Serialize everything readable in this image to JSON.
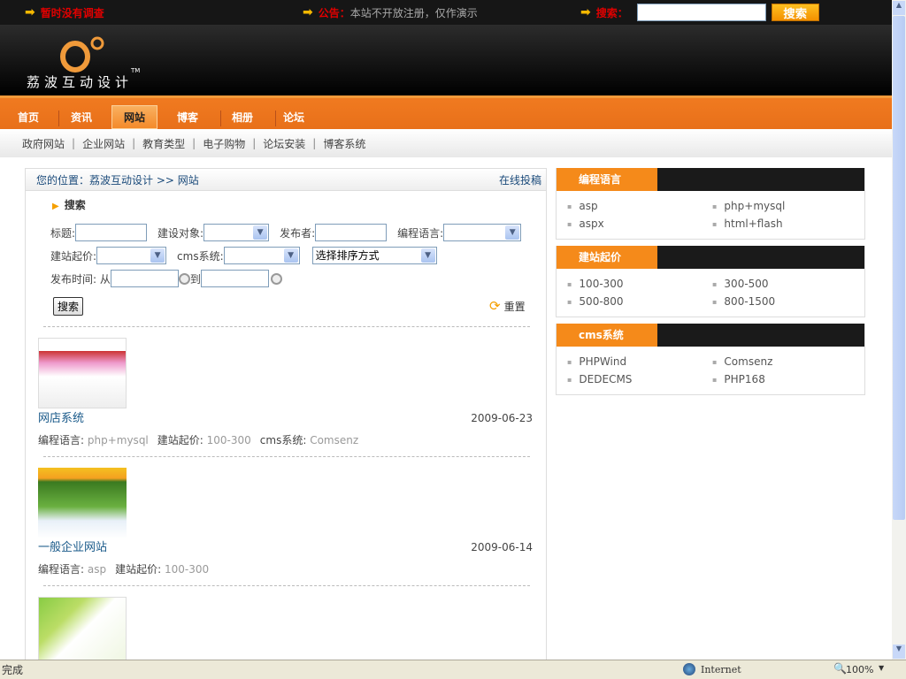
{
  "topbar": {
    "survey": "暂时没有调查",
    "notice_label": "公告：",
    "notice_text": "本站不开放注册，仅作演示",
    "search_label": "搜索：",
    "search_button": "搜索",
    "search_value": ""
  },
  "logo": {
    "text": "荔波互动设计",
    "tm": "TM"
  },
  "nav": [
    {
      "label": "首页"
    },
    {
      "label": "资讯"
    },
    {
      "label": "网站",
      "active": true
    },
    {
      "label": "博客"
    },
    {
      "label": "相册"
    },
    {
      "label": "论坛"
    }
  ],
  "subnav": [
    "政府网站",
    "企业网站",
    "教育类型",
    "电子购物",
    "论坛安装",
    "博客系统"
  ],
  "breadcrumb": {
    "prefix": "您的位置：",
    "home": "荔波互动设计",
    "sep": ">>",
    "current": "网站",
    "submit_link": "在线投稿"
  },
  "search": {
    "heading": "搜索",
    "title_label": "标题:",
    "target_label": "建设对象:",
    "publisher_label": "发布者:",
    "lang_label": "编程语言:",
    "price_label": "建站起价:",
    "cms_label": "cms系统:",
    "sort_placeholder": "选择排序方式",
    "time_label": "发布时间: 从",
    "to_label": "到",
    "submit": "搜索",
    "reset": "重置"
  },
  "items": [
    {
      "title": "网店系统",
      "date": "2009-06-23",
      "lang_label": "编程语言:",
      "lang": "php+mysql",
      "price_label": "建站起价:",
      "price": "100-300",
      "cms_label": "cms系统:",
      "cms": "Comsenz"
    },
    {
      "title": "一般企业网站",
      "date": "2009-06-14",
      "lang_label": "编程语言:",
      "lang": "asp",
      "price_label": "建站起价:",
      "price": "100-300"
    }
  ],
  "sidebar": [
    {
      "title": "编程语言",
      "items": [
        "asp",
        "php+mysql",
        "aspx",
        "html+flash"
      ]
    },
    {
      "title": "建站起价",
      "items": [
        "100-300",
        "300-500",
        "500-800",
        "800-1500"
      ]
    },
    {
      "title": "cms系统",
      "items": [
        "PHPWind",
        "Comsenz",
        "DEDECMS",
        "PHP168"
      ]
    }
  ],
  "status": {
    "text": "完成",
    "zone": "Internet",
    "zoom": "100%"
  }
}
